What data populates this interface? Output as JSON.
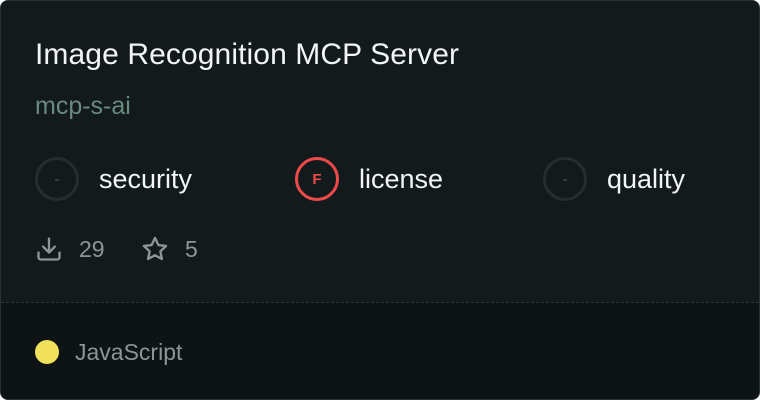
{
  "card": {
    "title": "Image Recognition MCP Server",
    "subtitle": "mcp-s-ai",
    "scores": [
      {
        "symbol": "-",
        "label": "security",
        "state": "empty"
      },
      {
        "symbol": "F",
        "label": "license",
        "state": "fail"
      },
      {
        "symbol": "-",
        "label": "quality",
        "state": "empty"
      }
    ],
    "downloads": "29",
    "stars": "5",
    "language": {
      "name": "JavaScript",
      "color": "#f1e05a"
    }
  },
  "colors": {
    "background": "#111719",
    "fail": "#ef4a4a",
    "subtitle": "#6a8a7d"
  },
  "icons": {
    "downloads": "download-icon",
    "stars": "star-icon"
  }
}
